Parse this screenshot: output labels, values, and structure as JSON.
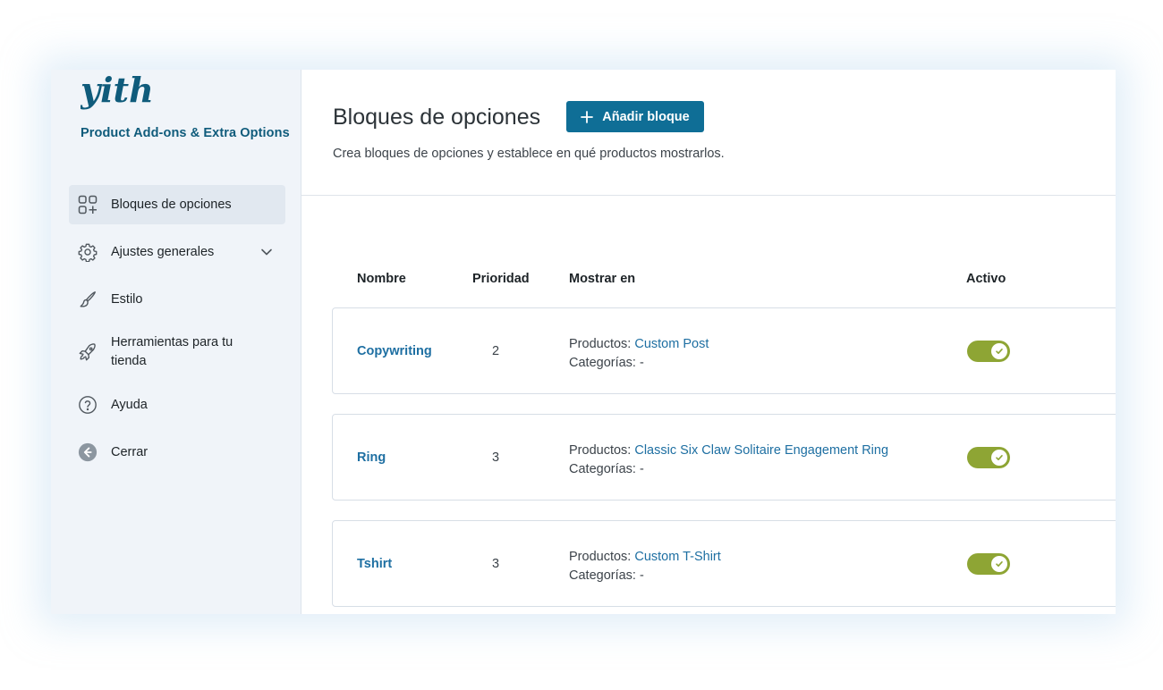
{
  "brand": {
    "logo_text": "yith",
    "subtitle": "Product Add-ons & Extra Options",
    "color": "#0f5b7b"
  },
  "sidebar": {
    "items": [
      {
        "label": "Bloques de opciones",
        "icon": "blocks-grid-plus-icon",
        "active": true
      },
      {
        "label": "Ajustes generales",
        "icon": "gear-icon",
        "expandable": true
      },
      {
        "label": "Estilo",
        "icon": "paint-brush-icon"
      },
      {
        "label": "Herramientas para tu tienda",
        "icon": "rocket-icon"
      },
      {
        "label": "Ayuda",
        "icon": "question-circle-icon"
      },
      {
        "label": "Cerrar",
        "icon": "back-arrow-circle-icon"
      }
    ]
  },
  "header": {
    "title": "Bloques de opciones",
    "add_button_label": "Añadir bloque",
    "description": "Crea bloques de opciones y establece en qué productos mostrarlos."
  },
  "table": {
    "columns": [
      "Nombre",
      "Prioridad",
      "Mostrar en",
      "Activo"
    ],
    "products_label": "Productos:",
    "categories_label": "Categorías:",
    "rows": [
      {
        "name": "Copywriting",
        "priority": "2",
        "products": "Custom Post",
        "categories": "-",
        "active": true
      },
      {
        "name": "Ring",
        "priority": "3",
        "products": "Classic Six Claw Solitaire Engagement Ring",
        "categories": "-",
        "active": true
      },
      {
        "name": "Tshirt",
        "priority": "3",
        "products": "Custom T-Shirt",
        "categories": "-",
        "active": true
      }
    ]
  },
  "colors": {
    "accent_button": "#0f6e96",
    "link": "#1e6fa2",
    "toggle_on": "#8ea534"
  }
}
